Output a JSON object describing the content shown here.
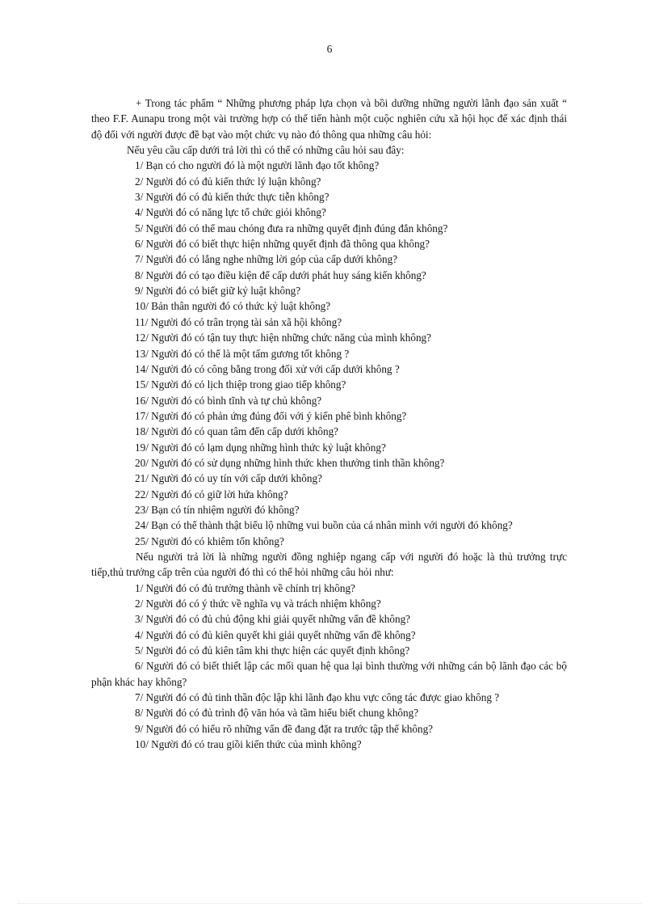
{
  "document": {
    "page_number": "6",
    "language": "vi",
    "intro_paragraphs": [
      "+ Trong tác phẩm “ Những phương pháp lựa chọn và bồi dưỡng những người lãnh đạo sản xuất “ theo  F.F. Aunapu  trong một vài  trường hợp  có thể  tiến hành   một cuộc nghiên  cứu xã hội học để xác định thái độ  đối với người  được đề bạt vào một chức vụ nào đó  thông  qua những  câu hỏi:",
      "Nếu yêu cầu cấp dưới trả lời thì có thể có những  câu hỏi  sau đây:"
    ],
    "questions_subordinates": [
      "1/ Bạn có cho người  đó là một người  lãnh  đạo tốt không?",
      "2/ Người  đó có đủ kiến thức lý luận  không?",
      "3/ Người  đó có đủ kiến thức thực tiễn  không?",
      "4/ Người  đó có năng  lực tổ chức giỏi  không?",
      "5/ Người  đó có thể  mau  chóng  đưa ra những  quyết định  đúng  đắn không?",
      "6/ Người  đó có biết thực hiện  những  quyết định  đã thông  qua không?",
      "7/ Người  đó có lắng  nghe  những  lời  góp  của cấp dưới không?",
      "8/ Người  đó có tạo điều  kiện  để cấp  dưới phát huy  sáng  kiến  không?",
      "9/ Người  đó có biết giữ  kỷ luật  không?",
      "10/ Bản thân người  đó có  thức kỷ luật  không?",
      "11/ Người  đó có trân trọng tài sản xã hội không?",
      "12/ Người  đó có tận tuy thực hiện  những  chức năng  của mình  không?",
      "13/ Người  đó có thể là một tấm gương  tốt không ?",
      "14/ Người  đó có công  bằng  trong  đối xử với  cấp dưới không ?",
      "15/ Người  đó có lịch  thiệp  trong giao  tiếp không?",
      "16/ Người  đó có bình  tĩnh  và tự chủ  không?",
      "17/ Người  đó có phản ứng đúng  đối với  ý kiến  phê bình  không?",
      "18/ Người  đó có quan tâm  đến cấp  dưới không?",
      "19/ Người  đó có lạm  dụng những  hình  thức kỷ luật  không?",
      "20/ Người  đó có sử dụng những  hình  thức khen thưởng  tinh  thần  không?",
      "21/ Người  đó có uy tín  với cấp  dưới không?",
      "22/ Người  đó có giữ  lời  hứa không?",
      "23/ Bạn có tín  nhiệm  người  đó không?",
      "24/ Bạn có thể  thành  thật biểu lộ   những  vui  buồn  của cá nhân mình   với  người  đó không?",
      "25/ Người  đó có khiêm  tốn không?"
    ],
    "transition_paragraph": "Nếu người  trả lời  là những  người  đồng nghiệp  ngang  cấp với  người  đó hoặc là thủ trưởng trực tiếp,thủ  trưởng cấp trên của người  đó thì  có thể  hỏi những  câu hỏi như:",
    "questions_peers_superiors": [
      "1/ Người  đó có đủ trưởng  thành  về chính  trị không?",
      "2/ Người  đó có ý thức về nghĩa  vụ và trách nhiệm  không?",
      "3/ Người  đó có đủ chủ động khi giải  quyết những  vấn  đề không?",
      "4/ Người  đó có đủ kiên  quyết khi giải  quyết những  vấn  đề không?",
      "5/ Người  đó có đủ kiên tâm  khi thực hiện  các quyết định  không?",
      "6/ Người  đó có biết thiết  lập các mối  quan hệ qua lại bình  thường  với những  cán bộ lãnh  đạo các bộ phận khác hay không?",
      "7/ Người  đó có đủ tinh  thần  độc lập  khi lãnh  đạo khu vực công  tác được giao  không ?",
      "8/ Người  đó có đủ trình  độ văn hóa và tầm hiểu  biết chung  không?",
      "9/ Người  đó có hiểu  rõ những  vấn  đề đang đặt ra  trước tập thể  không?",
      "10/ Người  đó có trau giồi  kiến  thức của mình  không?"
    ]
  }
}
